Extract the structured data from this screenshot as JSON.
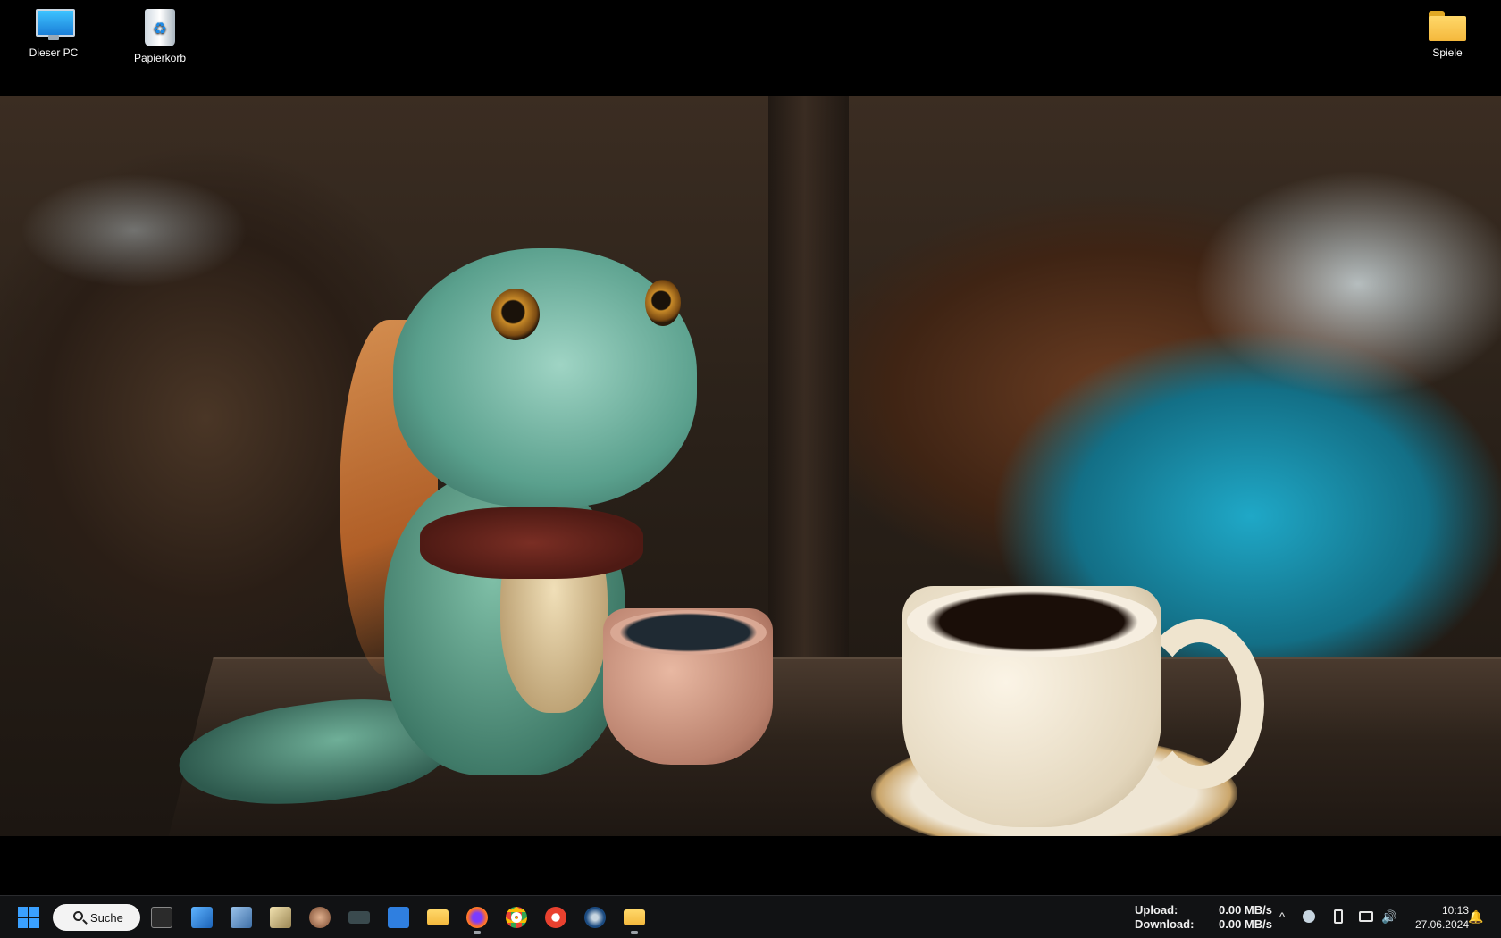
{
  "desktop": {
    "icons": [
      {
        "label": "Dieser PC",
        "icon": "this-pc-icon"
      },
      {
        "label": "Papierkorb",
        "icon": "recycle-bin-icon"
      },
      {
        "label": "Spiele",
        "icon": "folder-icon"
      }
    ]
  },
  "taskbar": {
    "search_label": "Suche",
    "apps": [
      {
        "name": "terminal",
        "color": "#2b2b2b"
      },
      {
        "name": "virtual-drive",
        "color": "#2b83d6"
      },
      {
        "name": "photo-viewer",
        "color": "#5b8fc7"
      },
      {
        "name": "excel-tool",
        "color": "#d9c48b"
      },
      {
        "name": "character-app",
        "color": "#b07a5a"
      },
      {
        "name": "keyboard-app",
        "color": "#3a4a4e"
      },
      {
        "name": "id-app",
        "color": "#2f7fe0"
      },
      {
        "name": "file-explorer",
        "color": "#f4b83c"
      },
      {
        "name": "firefox",
        "color": "#ff6d2b"
      },
      {
        "name": "chrome",
        "color": "#34a853"
      },
      {
        "name": "red-app",
        "color": "#e9412f"
      },
      {
        "name": "steam",
        "color": "#1b4a80"
      },
      {
        "name": "file-explorer-2",
        "color": "#f4b83c"
      }
    ],
    "network": {
      "upload_label": "Upload:",
      "upload_value": "0.00 MB/s",
      "download_label": "Download:",
      "download_value": "0.00 MB/s"
    },
    "clock": {
      "time": "10:13",
      "date": "27.06.2024"
    }
  }
}
